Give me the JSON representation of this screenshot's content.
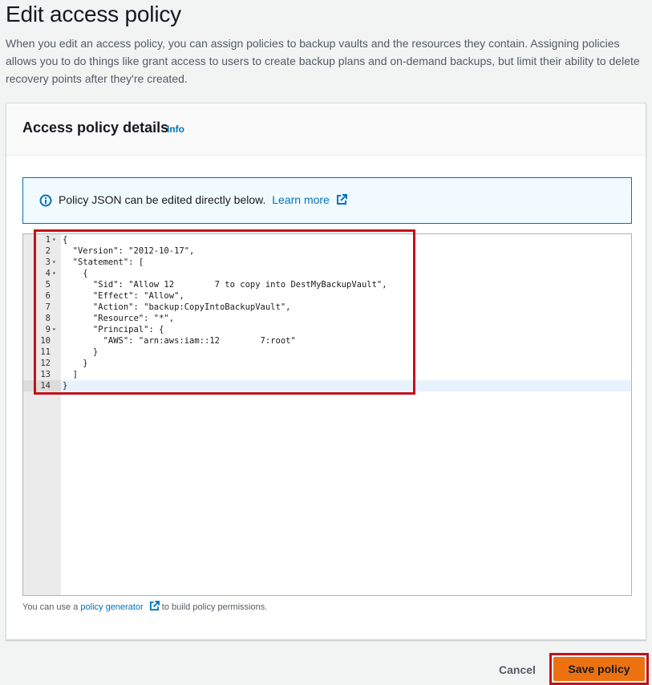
{
  "page": {
    "title": "Edit access policy",
    "description": "When you edit an access policy, you can assign policies to backup vaults and the resources they contain. Assigning policies allows you to do things like grant access to users to create backup plans and on-demand backups, but limit their ability to delete recovery points after they're created."
  },
  "panel": {
    "title": "Access policy details",
    "info_label": "Info"
  },
  "alert": {
    "text": "Policy JSON can be edited directly below.",
    "link_label": "Learn more"
  },
  "editor": {
    "lines": [
      {
        "n": "1",
        "text": "{"
      },
      {
        "n": "2",
        "text": "  \"Version\": \"2012-10-17\","
      },
      {
        "n": "3",
        "text": "  \"Statement\": ["
      },
      {
        "n": "4",
        "text": "    {"
      },
      {
        "n": "5",
        "text": "      \"Sid\": \"Allow 12        7 to copy into DestMyBackupVault\","
      },
      {
        "n": "6",
        "text": "      \"Effect\": \"Allow\","
      },
      {
        "n": "7",
        "text": "      \"Action\": \"backup:CopyIntoBackupVault\","
      },
      {
        "n": "8",
        "text": "      \"Resource\": \"*\","
      },
      {
        "n": "9",
        "text": "      \"Principal\": {"
      },
      {
        "n": "10",
        "text": "        \"AWS\": \"arn:aws:iam::12        7:root\""
      },
      {
        "n": "11",
        "text": "      }"
      },
      {
        "n": "12",
        "text": "    }"
      },
      {
        "n": "13",
        "text": "  ]"
      },
      {
        "n": "14",
        "text": "}"
      }
    ],
    "fold_lines": [
      "1",
      "3",
      "4",
      "9"
    ]
  },
  "helper": {
    "prefix": "You can use a",
    "link_label": "policy generator",
    "suffix": "to build policy permissions."
  },
  "actions": {
    "cancel_label": "Cancel",
    "save_label": "Save policy"
  },
  "colors": {
    "primary": "#ec7211",
    "link": "#0073bb",
    "highlight": "#c2121a"
  }
}
